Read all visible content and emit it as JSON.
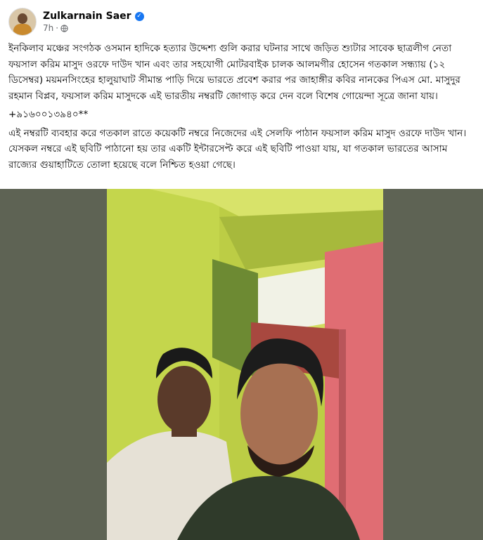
{
  "author": {
    "name": "Zulkarnain Saer",
    "time": "7h",
    "separator": "·",
    "verified_icon": "verified-badge-icon",
    "audience_icon": "globe-icon"
  },
  "post": {
    "paragraph1": "ইনকিলাব মঞ্চের সংগঠক ওসমান হাদিকে হত্যার উদ্দেশ্য গুলি করার ঘটনার সাথে জড়িত শ্যুটার সাবেক ছাত্রলীগ নেতা ফয়সাল করিম মাসুদ ওরফে দাউদ খান এবং তার সহযোগী মোটরবাইক চালক আলমগীর হোসেন গতকাল সন্ধ্যায় (১২ ডিসেম্বর) ময়মনসিংহের হালুয়াঘাট সীমান্ত পাড়ি দিয়ে ভারতে প্রবেশ করার পর জাহাঙ্গীর কবির নানকের পিএস মো. মাসুদুর রহমান বিপ্লব, ফয়সাল করিম মাসুদকে এই ভারতীয় নম্বরটি জোগাড় করে দেন বলে বিশেষ গোয়েন্দা সূত্রে জানা যায়।",
    "phone": "+৯১৬০০১৩৯৪০**",
    "paragraph2": "এই নম্বরটি ব্যবহার করে গতকাল রাতে কয়েকটি নম্বরে নিজেদের এই সেলফি পাঠান ফয়সাল করিম মাসুদ ওরফে দাউদ খান। যেসকল নম্বরে এই ছবিটি পাঠানো হয় তার একটি ইন্টারসেপ্ট করে এই ছবিটি পাওয়া যায়, যা গতকাল ভারতের আসাম রাজ্যের গুয়াহাটিতে তোলা হয়েছে বলে নিশ্চিত হওয়া গেছে।"
  },
  "colors": {
    "name_text": "#050505",
    "meta_text": "#65676b",
    "verified_blue": "#1877f2",
    "photo_backdrop": "#5e6354",
    "wall_green": "#c3d34d",
    "wall_pink": "#e06d73"
  }
}
